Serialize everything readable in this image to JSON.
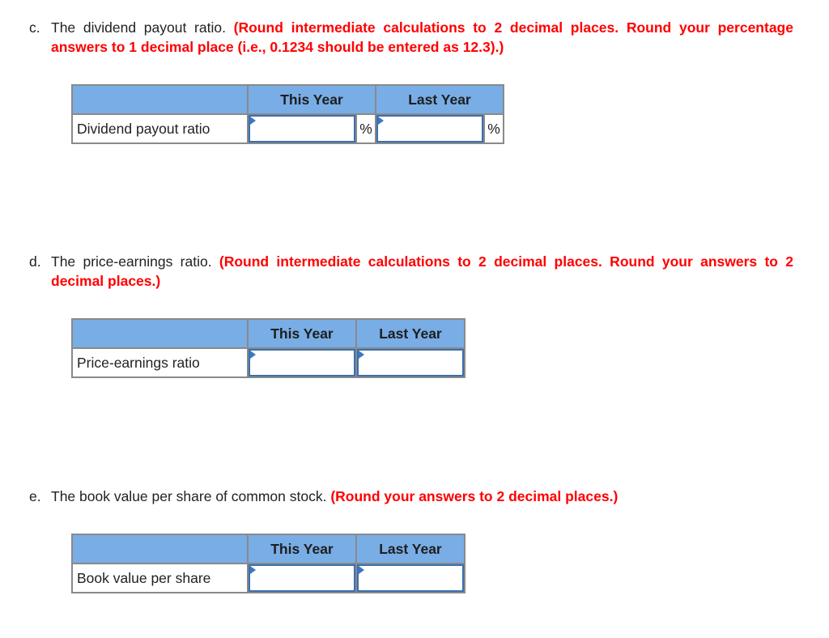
{
  "questions": [
    {
      "id": "c",
      "letter": "c.",
      "prompt": "The dividend payout ratio.",
      "note": "(Round intermediate calculations to 2 decimal places. Round your percentage answers to 1 decimal place (i.e., 0.1234 should be entered as 12.3).)",
      "table": {
        "columns": [
          "This Year",
          "Last Year"
        ],
        "row_label": "Dividend payout ratio",
        "unit_suffix": "%",
        "values": {
          "this_year": "",
          "last_year": ""
        }
      }
    },
    {
      "id": "d",
      "letter": "d.",
      "prompt": "The price-earnings ratio.",
      "note": "(Round intermediate calculations to 2 decimal places. Round your answers to 2 decimal places.)",
      "table": {
        "columns": [
          "This Year",
          "Last Year"
        ],
        "row_label": "Price-earnings ratio",
        "values": {
          "this_year": "",
          "last_year": ""
        }
      }
    },
    {
      "id": "e",
      "letter": "e.",
      "prompt": "The book value per share of common stock.",
      "note": "(Round your answers to 2 decimal places.)",
      "table": {
        "columns": [
          "This Year",
          "Last Year"
        ],
        "row_label": "Book value per share",
        "values": {
          "this_year": "",
          "last_year": ""
        }
      }
    }
  ],
  "colors": {
    "header_bg": "#79ade6",
    "note_red": "#ff0000",
    "input_border": "#3a6fb0",
    "grid_border": "#8a8a8a"
  }
}
